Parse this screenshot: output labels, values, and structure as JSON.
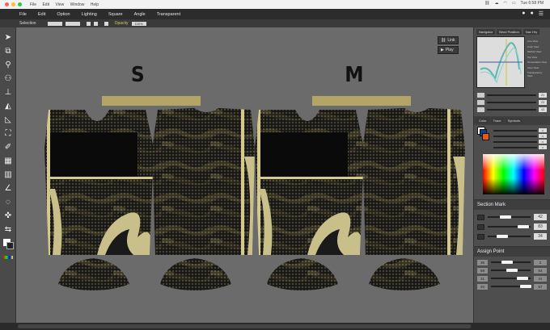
{
  "mac_menu": [
    "File",
    "Edit",
    "View",
    "Window",
    "Help"
  ],
  "mac_status": {
    "clock": "Tue 6:58 PM"
  },
  "app_menu": [
    "File",
    "Edit",
    "Option",
    "Lighting",
    "Square",
    "Angle",
    "Transparent"
  ],
  "options_bar": {
    "tool_label": "Selection",
    "opacity_label": "Opacity",
    "opacity_value": "100%"
  },
  "canvas": {
    "size_labels": [
      "S",
      "M"
    ],
    "buttons": {
      "link": "Link",
      "play": "Play"
    }
  },
  "navigator": {
    "tabs": [
      "Navigator",
      "Bend Position",
      "Nav Hry"
    ],
    "legend": [
      "Line View",
      "Color View",
      "Method View",
      "Top View",
      "Temperature View",
      "Inner View",
      "Transparency View"
    ],
    "rows": [
      {
        "value": "21"
      },
      {
        "value": "23"
      },
      {
        "value": "43"
      }
    ]
  },
  "color_panel": {
    "tabs": [
      "Color",
      "Trace",
      "Symbols"
    ],
    "rows": [
      "0",
      "0",
      "0",
      "0"
    ]
  },
  "section_mark": {
    "title": "Section Mark",
    "rows": [
      {
        "value": "42",
        "level": 0.42
      },
      {
        "value": "83",
        "level": 0.83
      },
      {
        "value": "34",
        "level": 0.34
      }
    ]
  },
  "assign_point": {
    "title": "Assign Point",
    "rows": [
      {
        "left": "36",
        "value": "2",
        "level": 0.4
      },
      {
        "left": "69",
        "value": "54",
        "level": 0.54
      },
      {
        "left": "21",
        "value": "41",
        "level": 0.8
      },
      {
        "left": "40",
        "value": "87",
        "level": 0.87
      }
    ]
  },
  "colors": {
    "gold": "#b4a466",
    "camo_dark": "#141414",
    "camo_olive": "#5b5432",
    "accent": "#c8bf8a"
  }
}
